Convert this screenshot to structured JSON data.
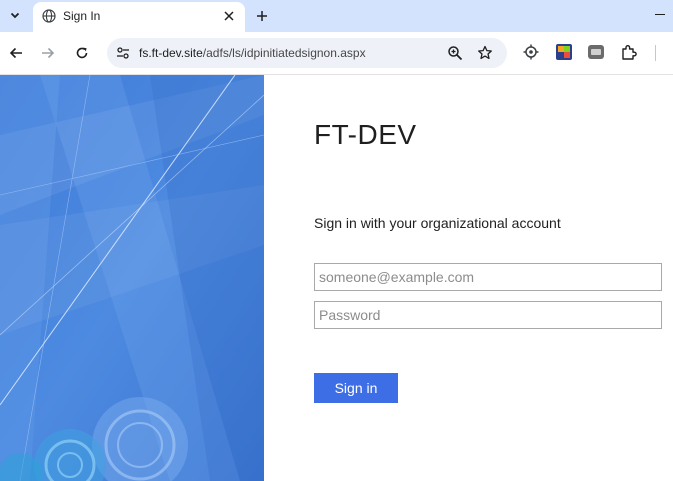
{
  "browser": {
    "tab": {
      "title": "Sign In"
    },
    "address_bar": {
      "host": "fs.ft-dev.site",
      "path": "/adfs/ls/idpinitiatedsignon.aspx"
    }
  },
  "page": {
    "company_name": "FT-DEV",
    "heading": "Sign in with your organizational account",
    "username": {
      "value": "",
      "placeholder": "someone@example.com"
    },
    "password": {
      "value": "",
      "placeholder": "Password"
    },
    "submit_label": "Sign in"
  },
  "colors": {
    "tabstrip": "#d3e3fd",
    "hero_blue": "#4a84db",
    "button_blue": "#3d6ee6"
  }
}
